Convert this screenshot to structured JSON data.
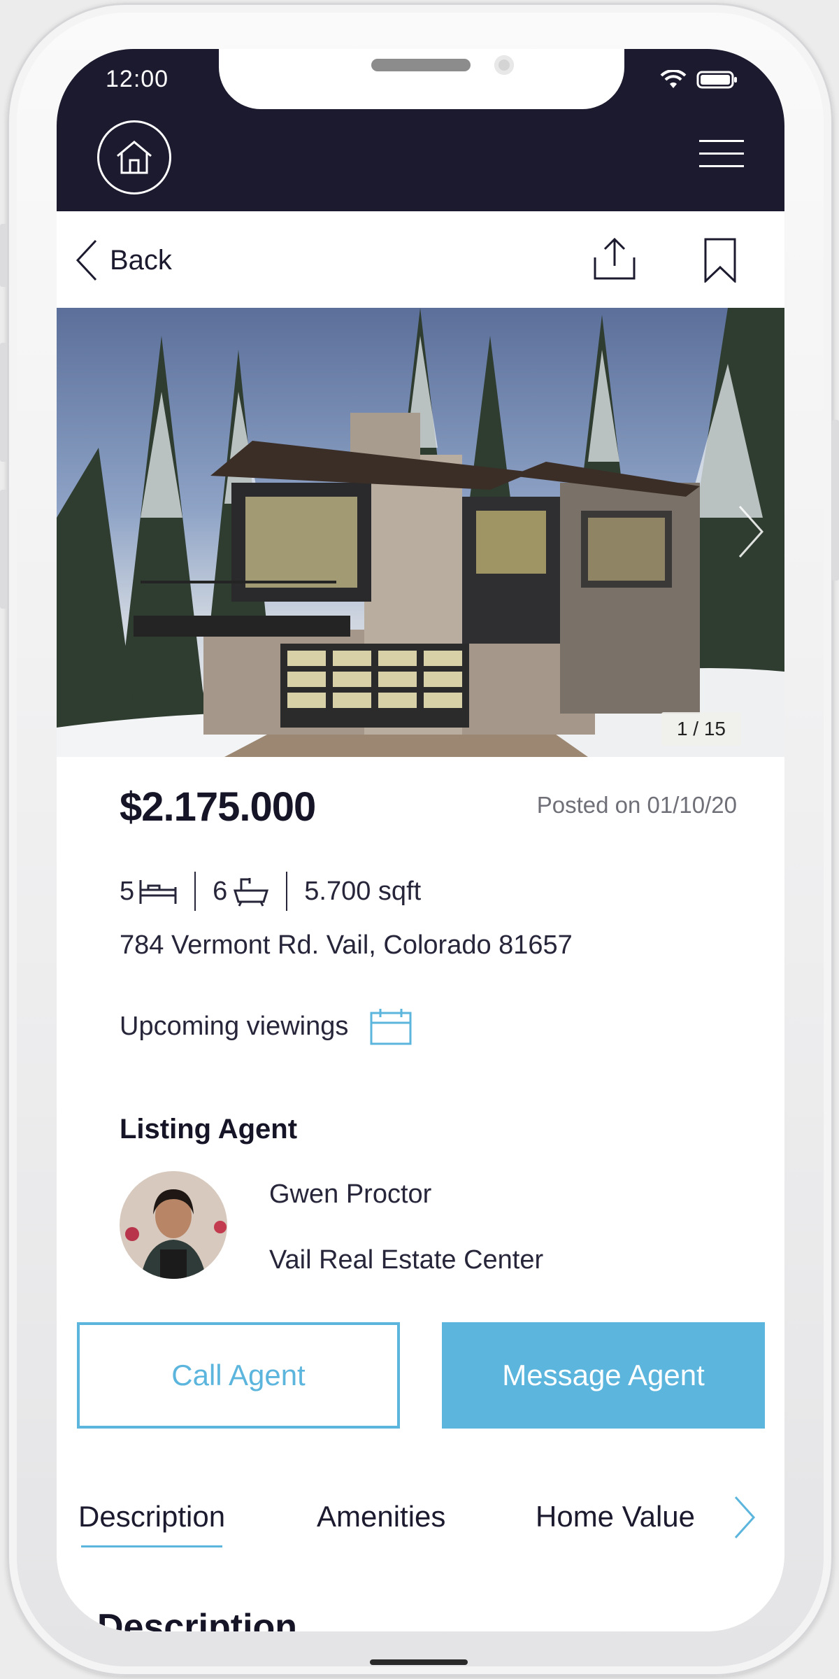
{
  "status_bar": {
    "time": "12:00"
  },
  "header": {
    "logo_icon": "home-icon",
    "menu_icon": "hamburger-icon"
  },
  "subnav": {
    "back_label": "Back",
    "share_icon": "share-icon",
    "bookmark_icon": "bookmark-icon"
  },
  "gallery": {
    "counter": "1 / 15"
  },
  "listing": {
    "price": "$2.175.000",
    "posted": "Posted on 01/10/20",
    "beds": "5",
    "baths": "6",
    "area": "5.700 sqft",
    "address": "784 Vermont Rd.  Vail, Colorado 81657",
    "viewings_label": "Upcoming viewings"
  },
  "agent": {
    "section_title": "Listing Agent",
    "name": "Gwen Proctor",
    "company": "Vail Real Estate Center",
    "call_label": "Call Agent",
    "message_label": "Message Agent"
  },
  "tabs": [
    {
      "label": "Description",
      "active": true
    },
    {
      "label": "Amenities",
      "active": false
    },
    {
      "label": "Home Value",
      "active": false
    }
  ],
  "section_peek": "Description",
  "colors": {
    "header_bg": "#1c1a2e",
    "accent": "#5cb5dd",
    "text": "#26253a"
  }
}
